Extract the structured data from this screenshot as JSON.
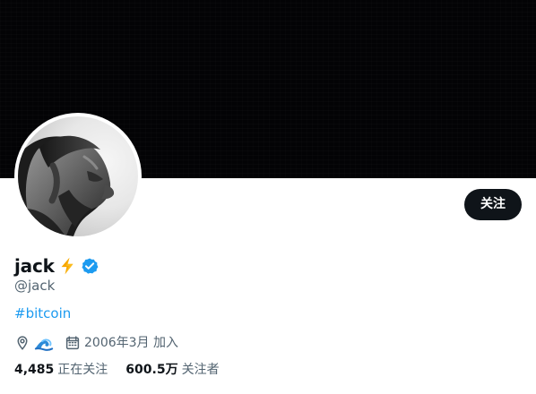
{
  "profile": {
    "display_name": "jack",
    "display_emoji": "⚡",
    "handle": "@jack",
    "bio_hashtag": "#bitcoin",
    "location_emoji": "🌊",
    "joined_text": "2006年3月 加入"
  },
  "actions": {
    "follow_label": "关注"
  },
  "stats": {
    "following_count": "4,485",
    "following_label": "正在关注",
    "followers_count": "600.5万",
    "followers_label": "关注者"
  },
  "icons": {
    "location": "location-pin-icon",
    "calendar": "calendar-icon",
    "verified": "verified-badge-icon",
    "lightning": "lightning-icon",
    "wave": "wave-icon"
  },
  "colors": {
    "banner": "#030305",
    "primary_text": "#0f1419",
    "secondary_text": "#536471",
    "link": "#1d9bf0",
    "follow_button": "#0f1419"
  }
}
